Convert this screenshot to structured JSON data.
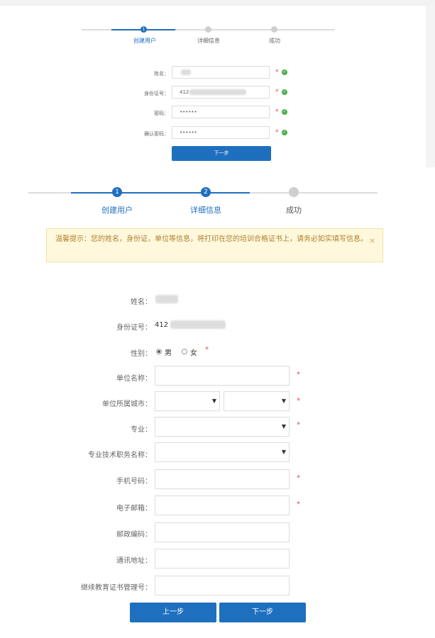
{
  "step1": {
    "steps": [
      {
        "number": "1",
        "label": "创建用户"
      },
      {
        "number": "",
        "label": "详细信息"
      },
      {
        "number": "",
        "label": "成功"
      }
    ],
    "fields": [
      {
        "label": "姓名：",
        "value": "",
        "required": "*"
      },
      {
        "label": "身份证号：",
        "value": "412",
        "required": "*"
      },
      {
        "label": "密码：",
        "value": "••••••",
        "required": "*"
      },
      {
        "label": "确认密码：",
        "value": "••••••",
        "required": "*"
      }
    ],
    "next_button": "下一步"
  },
  "step2": {
    "steps": [
      {
        "number": "1",
        "label": "创建用户"
      },
      {
        "number": "2",
        "label": "详细信息"
      },
      {
        "number": "",
        "label": "成功"
      }
    ],
    "notice": {
      "text": "温馨提示：您的姓名，身份证，单位等信息，将打印在您的培训合格证书上，请务必如实填写信息。",
      "close": "×"
    },
    "fields": {
      "name_label": "姓名：",
      "name_value": "",
      "id_label": "身份证号：",
      "id_value": "412",
      "gender_label": "性别：",
      "gender_male": "男",
      "gender_female": "女",
      "gender_required": "*",
      "unit_label": "单位名称：",
      "unit_value": "",
      "unit_required": "*",
      "city_label": "单位所属城市：",
      "city_value": "",
      "city2_value": "",
      "city_required": "*",
      "major_label": "专业：",
      "major_value": "",
      "major_required": "*",
      "tech_label": "专业技术职务名称：",
      "tech_value": "",
      "phone_label": "手机号码：",
      "phone_value": "",
      "phone_required": "*",
      "email_label": "电子邮箱：",
      "email_value": "",
      "email_required": "*",
      "postcode_label": "邮政编码：",
      "postcode_value": "",
      "address_label": "通讯地址：",
      "address_value": "",
      "cert_label": "继续教育证书管理号：",
      "cert_value": ""
    },
    "prev_button": "上一步",
    "next_button": "下一步"
  },
  "colors": {
    "accent": "#1f6fbf",
    "required": "#e04a4a",
    "ok": "#4caf50",
    "notice_bg": "#fff8dc"
  }
}
